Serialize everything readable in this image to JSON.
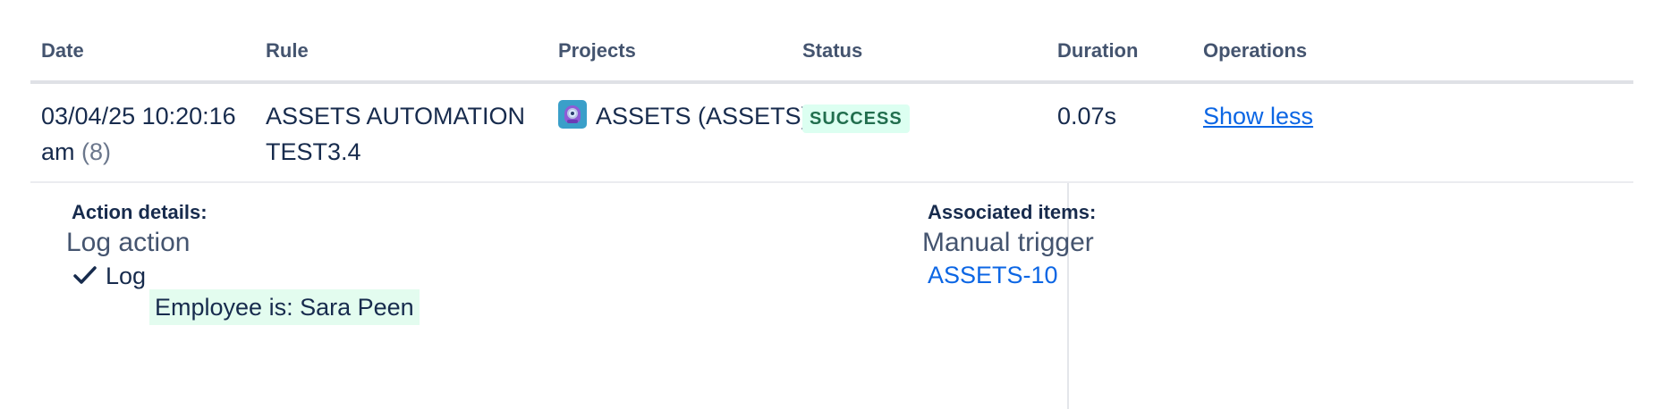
{
  "headers": {
    "date": "Date",
    "rule": "Rule",
    "projects": "Projects",
    "status": "Status",
    "duration": "Duration",
    "operations": "Operations"
  },
  "row": {
    "date_line1": "03/04/25 10:20:16",
    "date_line2": "am",
    "date_count": "(8)",
    "rule_line1": "ASSETS AUTOMATION",
    "rule_line2": "TEST3.4",
    "project": "ASSETS (ASSETS)",
    "project_icon": "project-avatar-icon",
    "status": "SUCCESS",
    "duration": "0.07s",
    "operation": "Show less"
  },
  "details": {
    "action_title": "Action details:",
    "action_name": "Log action",
    "log_label": "Log",
    "log_icon": "check-icon",
    "log_message": "Employee is: Sara Peen",
    "assoc_title": "Associated items:",
    "assoc_trigger": "Manual trigger",
    "assoc_item": "ASSETS-10"
  },
  "colors": {
    "success_bg": "#dcfff1",
    "success_text": "#216e4e",
    "link": "#0c66e4",
    "log_highlight": "#e3fcef"
  }
}
